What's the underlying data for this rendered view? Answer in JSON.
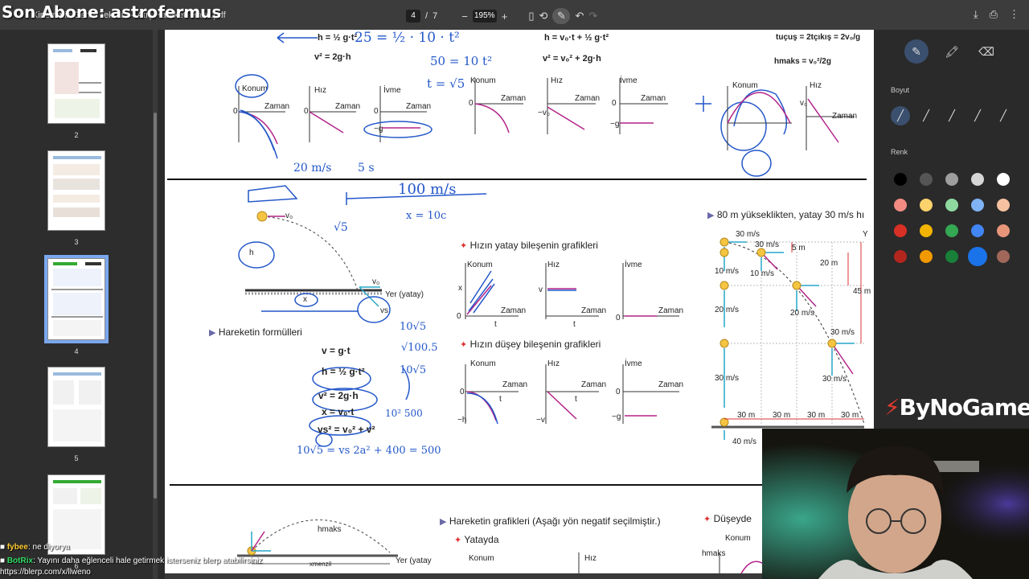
{
  "overlay": {
    "title": "Son Abone: astrofermus"
  },
  "toolbar": {
    "file_name": "Kinematik Genel Tekrar — Atış Hareketi Hava.pdf",
    "page_current": "4",
    "page_sep": "/",
    "page_total": "7",
    "zoom": "195%",
    "minus": "−",
    "plus": "+"
  },
  "thumbnails": [
    {
      "num": "2"
    },
    {
      "num": "3"
    },
    {
      "num": "4"
    },
    {
      "num": "5"
    },
    {
      "num": "6"
    }
  ],
  "tools": {
    "size_label": "Boyut",
    "color_label": "Renk",
    "colors": [
      "#000000",
      "#555555",
      "#9e9e9e",
      "#d6d6d6",
      "#ffffff",
      "#f28b82",
      "#fbd26b",
      "#8fd9a0",
      "#7fb3f5",
      "#f6c1a0",
      "#d93025",
      "#f2b400",
      "#34a853",
      "#4285f4",
      "#e8967a",
      "#b3261e",
      "#f29900",
      "#188038",
      "#1a73e8",
      "#a0675a"
    ]
  },
  "top_section": {
    "formula_left_a": "h = ½ g·t²",
    "formula_left_b": "v² = 2g·h",
    "formula_mid_a": "h = v₀·t + ½ g·t²",
    "formula_mid_b": "v² = v₀² + 2g·h",
    "formula_right_a": "tuçuş = 2tçıkış = 2v₀/g",
    "formula_right_b": "hmaks = v₀²/2g",
    "konum": "Konum",
    "hiz": "Hız",
    "ivme": "İvme",
    "zaman": "Zaman",
    "zero": "0",
    "minus_g": "−g",
    "minus_v0": "−v₀",
    "v0": "v₀"
  },
  "middle_section": {
    "formulas_title": "Hareketin formülleri",
    "f1": "v = g·t",
    "f2": "h = ½ g·t²",
    "f3": "v² = 2g·h",
    "f4": "x = v₀·t",
    "f5": "vs² = v₀² + v²",
    "ground": "Yer (yatay)",
    "h": "h",
    "x": "x",
    "v0": "v₀",
    "vs": "vs",
    "horizontal_title": "Hızın yatay bileşenin grafikleri",
    "vertical_title": "Hızın düşey bileşenin grafikleri",
    "konum": "Konum",
    "hiz": "Hız",
    "ivme": "İvme",
    "zaman": "Zaman",
    "t": "t",
    "zero": "0",
    "xl": "x",
    "vl": "v",
    "minus_h": "−h",
    "minus_v": "−v",
    "minus_g": "−g",
    "right_title": "80 m yükseklikten, yatay 30 m/s hı",
    "speeds": [
      "30 m/s",
      "30 m/s",
      "10 m/s",
      "10 m/s",
      "20 m/s",
      "20 m/s",
      "30 m/s",
      "30 m/s",
      "30 m/s",
      "40 m/s"
    ],
    "heights": [
      "5 m",
      "20 m",
      "45 m"
    ],
    "dists": [
      "30 m",
      "30 m",
      "30 m",
      "30 m"
    ],
    "y_label": "Y"
  },
  "bottom_section": {
    "graphs_title": "Hareketin grafikleri (Aşağı yön negatif seçilmiştir.)",
    "yatayda": "Yatayda",
    "duseyde": "Düşeyde",
    "konum": "Konum",
    "hiz": "Hız",
    "hmaks": "hmaks",
    "ground": "Yer (yatay",
    "xmenzil": "xmenzil"
  },
  "handwriting": {
    "a": "25 = ½ · 10 · t²",
    "b": "50 = 10 t²",
    "c": "t = √5",
    "d": "20 m/s",
    "e": "5 s",
    "f": "100 m/s",
    "g": "x = 10c",
    "h": "√5",
    "i": "10√5",
    "j": "√100.5",
    "k": "10√5",
    "l": "10²  500",
    "m": "10√5 = vs  2a² + 400 = 500"
  },
  "chat": [
    {
      "name": "fybee",
      "text": ": ne diyorya"
    },
    {
      "name": "BotRix",
      "text": ": Yayını daha eğlenceli hale getirmek isterseniz blerp atabilirsiniz"
    },
    {
      "name": "",
      "text": "https://blerp.com/x/llweno"
    }
  ],
  "brand": {
    "text": "ByNoGame"
  }
}
